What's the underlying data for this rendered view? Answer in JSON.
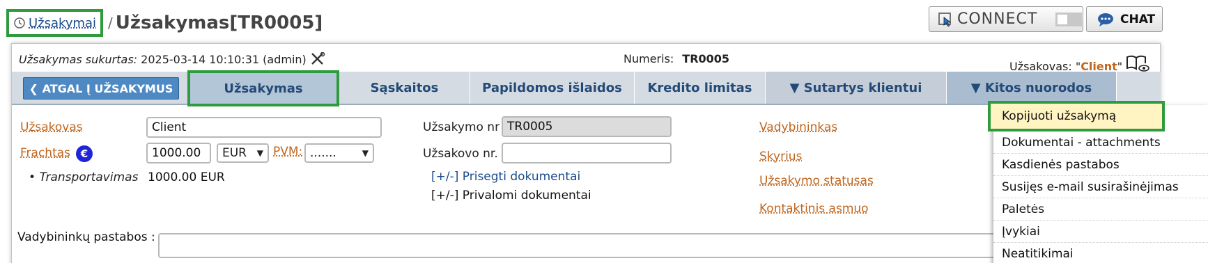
{
  "breadcrumb": {
    "link": "Užsakymai",
    "separator": "/",
    "title": "Užsakymas[TR0005]"
  },
  "topbar": {
    "connect_label": "CONNECT",
    "chat_label": "CHAT"
  },
  "meta": {
    "created_label": "Užsakymas sukurtas:",
    "created_value": "2025-03-14 10:10:31 (admin)",
    "number_label": "Numeris:",
    "number_value": "TR0005",
    "client_label": "Užsakovas: \"",
    "client_value": "Client",
    "client_suffix": "\""
  },
  "tabs": {
    "back": "❮ ATGAL Į UŽSAKYMUS",
    "items": [
      "Užsakymas",
      "Sąskaitos",
      "Papildomos išlaidos",
      "Kredito limitas",
      "▼ Sutartys klientui",
      "▼ Kitos nuorodos"
    ]
  },
  "form": {
    "client_label": "Užsakovas",
    "client_value": "Client",
    "freight_label": "Frachtas",
    "freight_value": "1000.00",
    "currency": "EUR",
    "vat_label": "PVM:",
    "vat_value": ".......",
    "transport_label": "Transportavimas",
    "transport_value": "1000.00 EUR",
    "order_nr_label": "Užsakymo nr",
    "order_nr_value": "TR0005",
    "client_nr_label": "Užsakovo nr. :",
    "client_nr_value": "",
    "attach_docs": "[+/-] Prisegti dokumentai",
    "required_docs": "[+/-] Privalomi dokumentai",
    "manager_label": "Vadybininkas",
    "department_label": "Skyrius",
    "status_label": "Užsakymo statusas",
    "contact_label": "Kontaktinis asmuo",
    "notes_label": "Vadybininkų pastabos :",
    "notes_value": ""
  },
  "menu": {
    "items": [
      "Kopijuoti užsakymą",
      "Dokumentai - attachments",
      "Kasdienės pastabos",
      "Susijęs e-mail susirašinėjimas",
      "Paletės",
      "Įvykiai",
      "Neatitikimai"
    ]
  },
  "colors": {
    "accent_orange": "#c0651c",
    "link_blue": "#1a4b8c",
    "highlight_green": "#2e9c3e",
    "tab_bar": "#d5dbe3"
  }
}
